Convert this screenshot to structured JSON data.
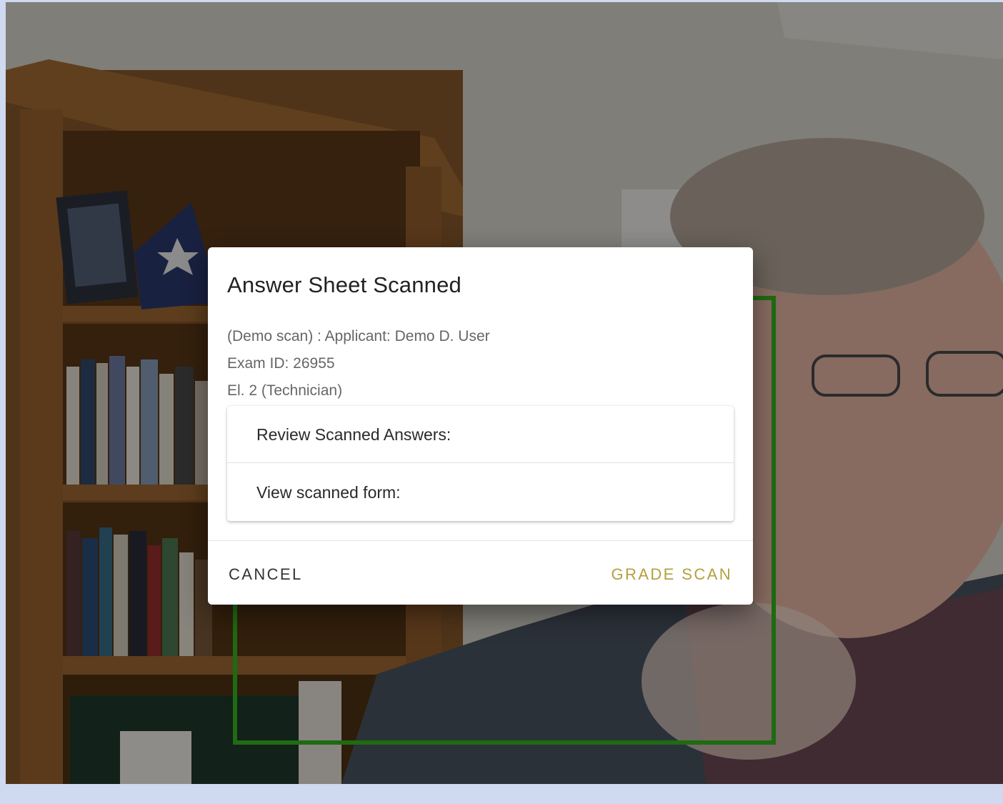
{
  "dialog": {
    "title": "Answer Sheet Scanned",
    "applicant_line": "(Demo scan) : Applicant: Demo D. User",
    "exam_id_line": "Exam ID: 26955",
    "element_line": "El. 2 (Technician)",
    "panels": [
      {
        "label": "Review Scanned Answers:"
      },
      {
        "label": "View scanned form:"
      }
    ],
    "actions": {
      "cancel_label": "CANCEL",
      "grade_label": "GRADE SCAN"
    }
  },
  "colors": {
    "accent": "#b3a03f",
    "scan_guide": "#1f6b12",
    "page_edge": "#cfd9ef"
  }
}
